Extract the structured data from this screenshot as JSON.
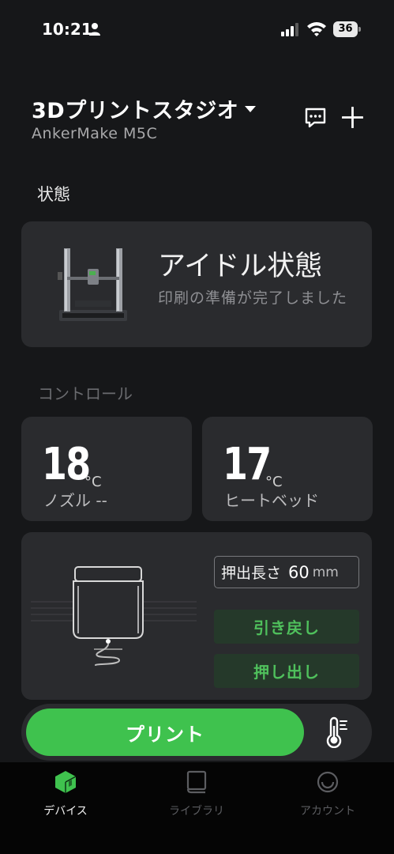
{
  "status_bar": {
    "time": "10:21",
    "battery": "36"
  },
  "header": {
    "title": "3Dプリントスタジオ",
    "model": "AnkerMake M5C"
  },
  "status_section": {
    "heading": "状態",
    "state": "アイドル状態",
    "description": "印刷の準備が完了しました"
  },
  "control_section": {
    "heading": "コントロール",
    "nozzle": {
      "value": "18",
      "unit": "°C",
      "label": "ノズル --"
    },
    "bed": {
      "value": "17",
      "unit": "°C",
      "label": "ヒートベッド"
    },
    "extrude": {
      "length_label": "押出長さ",
      "length_value": "60",
      "length_unit": "mm",
      "retract_label": "引き戻し",
      "extrude_label": "押し出し"
    }
  },
  "print_bar": {
    "print_label": "プリント"
  },
  "tabs": [
    {
      "label": "デバイス",
      "active": true
    },
    {
      "label": "ライブラリ",
      "active": false
    },
    {
      "label": "アカウント",
      "active": false
    }
  ],
  "colors": {
    "background": "#161719",
    "card": "#2a2b2e",
    "accent_green": "#3fc24e",
    "action_text": "#4fc05c"
  }
}
